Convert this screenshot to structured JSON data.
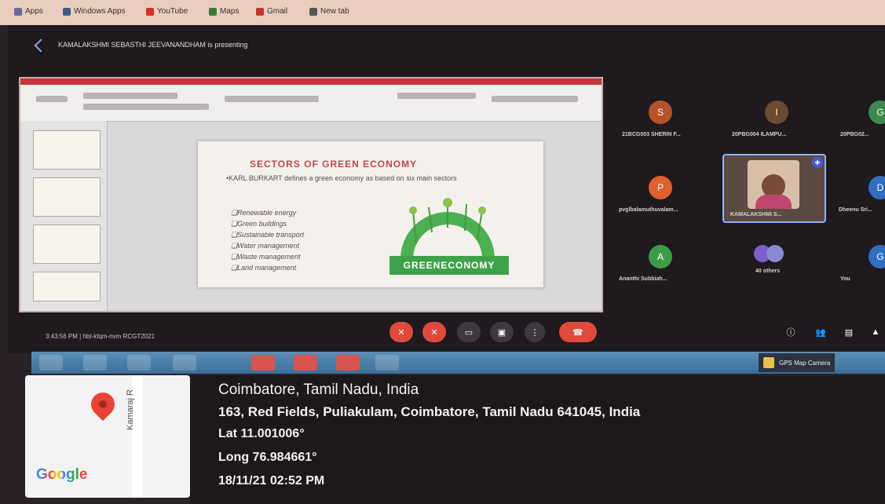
{
  "bookmarks": [
    {
      "label": "Apps",
      "color": "#6a6aa0"
    },
    {
      "label": "Windows Apps",
      "color": "#3d5a8a"
    },
    {
      "label": "YouTube",
      "color": "#d93025"
    },
    {
      "label": "Maps",
      "color": "#3a7a3a"
    },
    {
      "label": "Gmail",
      "color": "#c0392b"
    },
    {
      "label": "New tab",
      "color": "#555555"
    }
  ],
  "meet": {
    "presenting_text": "KAMALAKSHMI SEBASTHI JEEVANANDHAM is presenting",
    "meeting_info": "3:43:56 PM  |  hbt-kfqm-nvm  RCGT2021",
    "participants": [
      {
        "name": "21BCG003 SHERIN F...",
        "initial": "S",
        "color": "#b5522a"
      },
      {
        "name": "20PBG004 ILAMPU...",
        "initial": "I",
        "color": "#6b4a2f"
      },
      {
        "name": "20PBG02...",
        "initial": "G",
        "color": "#3e8a4e"
      },
      {
        "name": "pvglbalamuthuvalam...",
        "initial": "P",
        "color": "#e0602e"
      },
      {
        "name": "KAMALAKSHMI S...",
        "initial": "",
        "color": "#4a5ad0"
      },
      {
        "name": "Dheenu Sri...",
        "initial": "D",
        "color": "#2f6fc2"
      },
      {
        "name": "Ananthi Subbiah...",
        "initial": "A",
        "color": "#3e9c48"
      },
      {
        "name": "40 others",
        "initial": "",
        "color": "#7b5fc9"
      },
      {
        "name": "You",
        "initial": "G",
        "color": "#2f6fc2"
      }
    ]
  },
  "slide": {
    "title": "SECTORS OF GREEN ECONOMY",
    "intro": "•KARL BURKART defines a green economy as based on six main sectors",
    "sectors": [
      "❏Renewable energy",
      "❏Green buildings",
      "❏Sustainable transport",
      "❏Water management",
      "❏Waste management",
      "❏Land management"
    ],
    "logo_text": "GREENECONOMY"
  },
  "taskbar": {
    "gps_label": "GPS Map Camera"
  },
  "map": {
    "road_label": "Kamaraj R",
    "logo": "Google"
  },
  "location": {
    "city": "Coimbatore, Tamil Nadu, India",
    "address": "163, Red Fields, Puliakulam, Coimbatore, Tamil Nadu 641045, India",
    "lat": "Lat 11.001006°",
    "long": "Long 76.984661°",
    "timestamp": "18/11/21 02:52 PM"
  }
}
